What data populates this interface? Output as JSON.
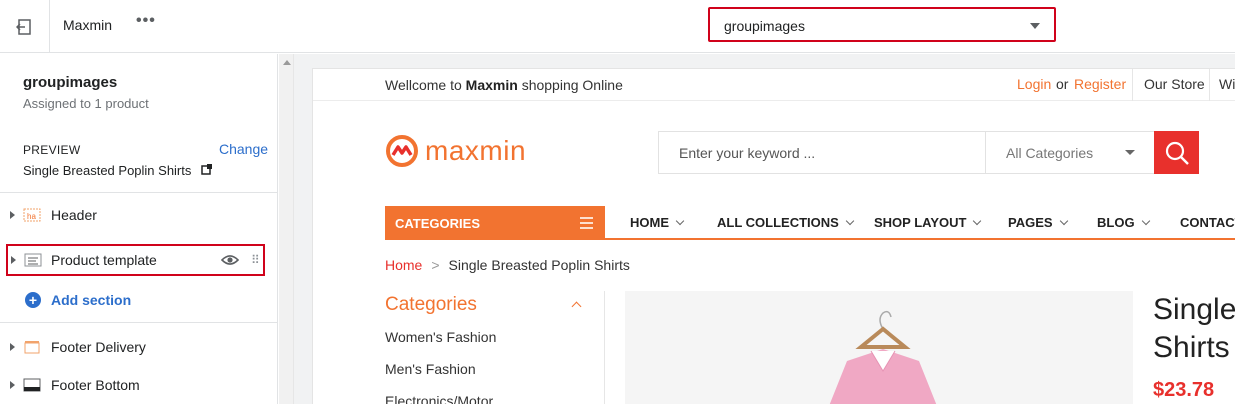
{
  "topbar": {
    "theme_name": "Maxmin",
    "more_label": "•••",
    "template_select": "groupimages"
  },
  "sidebar": {
    "template_title": "groupimages",
    "assigned": "Assigned to 1 product",
    "preview_label": "PREVIEW",
    "change_label": "Change",
    "preview_product": "Single Breasted Poplin Shirts",
    "sections": [
      {
        "label": "Header",
        "icon": "header-icon"
      },
      {
        "label": "Product template",
        "icon": "template-icon"
      },
      {
        "label": "Footer Delivery",
        "icon": "footer-delivery-icon"
      },
      {
        "label": "Footer Bottom",
        "icon": "footer-bottom-icon"
      }
    ],
    "add_section": "Add section"
  },
  "store": {
    "welcome_prefix": "Wellcome to",
    "welcome_brand": "Maxmin",
    "welcome_suffix": "shopping Online",
    "login": "Login",
    "or": "or",
    "register": "Register",
    "our_store": "Our Store",
    "wi": "Wi",
    "logo_text": "maxmin",
    "search_placeholder": "Enter your keyword ...",
    "search_category": "All Categories",
    "categories_bar": "CATEGORIES",
    "nav": [
      "HOME",
      "ALL COLLECTIONS",
      "SHOP LAYOUT",
      "PAGES",
      "BLOG",
      "CONTACT"
    ],
    "breadcrumb_home": "Home",
    "breadcrumb_sep": ">",
    "breadcrumb_current": "Single Breasted Poplin Shirts",
    "categories_title": "Categories",
    "category_items": [
      "Women's Fashion",
      "Men's Fashion",
      "Electronics/Motor"
    ],
    "product_title_line1": "Single",
    "product_title_line2": "Shirts",
    "product_price": "$23.78"
  },
  "colors": {
    "accent": "#f27330",
    "red": "#e8302c",
    "highlight": "#d0021b",
    "link": "#2c6ecb"
  }
}
